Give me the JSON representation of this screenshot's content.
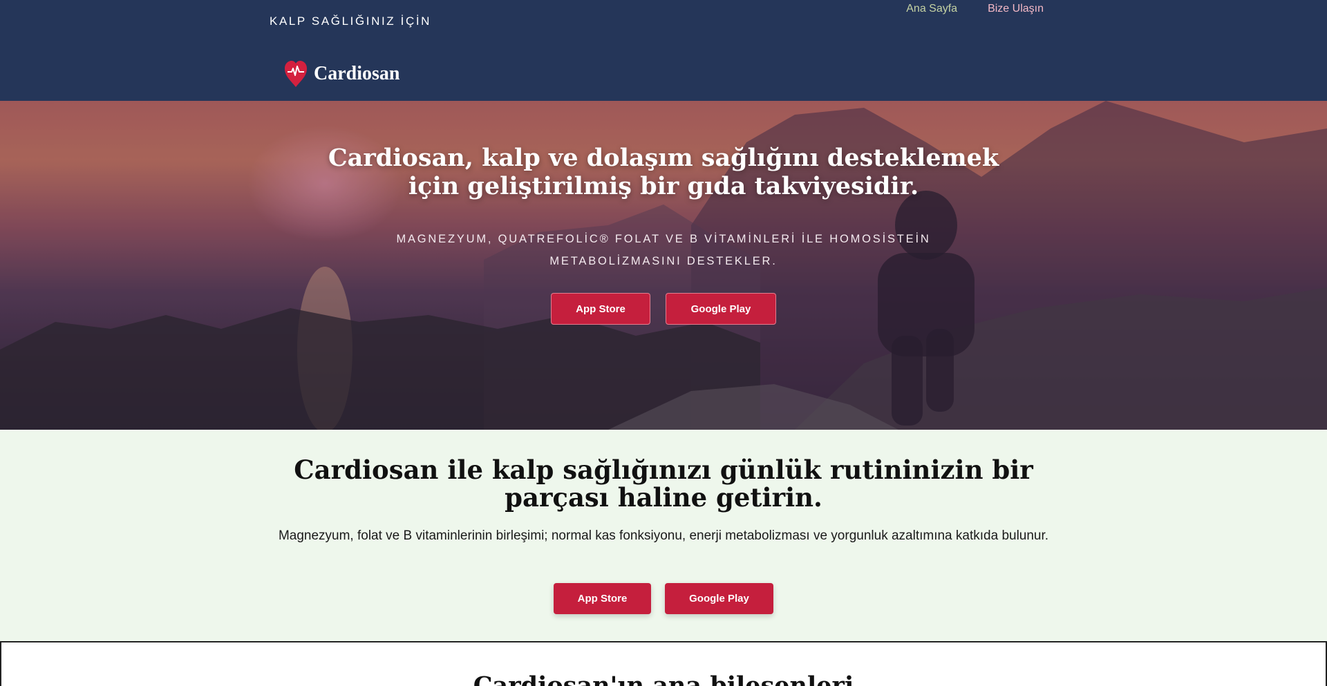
{
  "header": {
    "tagline": "KALP SAĞLIĞINIZ İÇİN",
    "nav": [
      {
        "label": "Ana Sayfa"
      },
      {
        "label": "Bize Ulaşın"
      }
    ],
    "brand_name": "Cardiosan",
    "logo_icon": "heart-pulse-icon",
    "background_color": "#253659"
  },
  "hero": {
    "title": "Cardiosan, kalp ve dolaşım sağlığını desteklemek için geliştirilmiş bir gıda takviyesidir.",
    "subtitle": "MAGNEZYUM, QUATREFOLİC® FOLAT VE B VİTAMİNLERİ İLE HOMOSİSTEİN METABOLİZMASINI DESTEKLER.",
    "buttons": [
      {
        "label": "App Store"
      },
      {
        "label": "Google Play"
      }
    ]
  },
  "routine": {
    "title": "Cardiosan ile kalp sağlığınızı günlük rutininizin bir parçası haline getirin.",
    "text": "Magnezyum, folat ve B vitaminlerinin birleşimi; normal kas fonksiyonu, enerji metabolizması ve yorgunluk azaltımına katkıda bulunur.",
    "buttons": [
      {
        "label": "App Store"
      },
      {
        "label": "Google Play"
      }
    ],
    "background_color": "#eef7ec"
  },
  "ingredients": {
    "title": "Cardiosan'ın ana bileşenleri"
  },
  "colors": {
    "accent": "#c51f3d",
    "header": "#253659"
  }
}
